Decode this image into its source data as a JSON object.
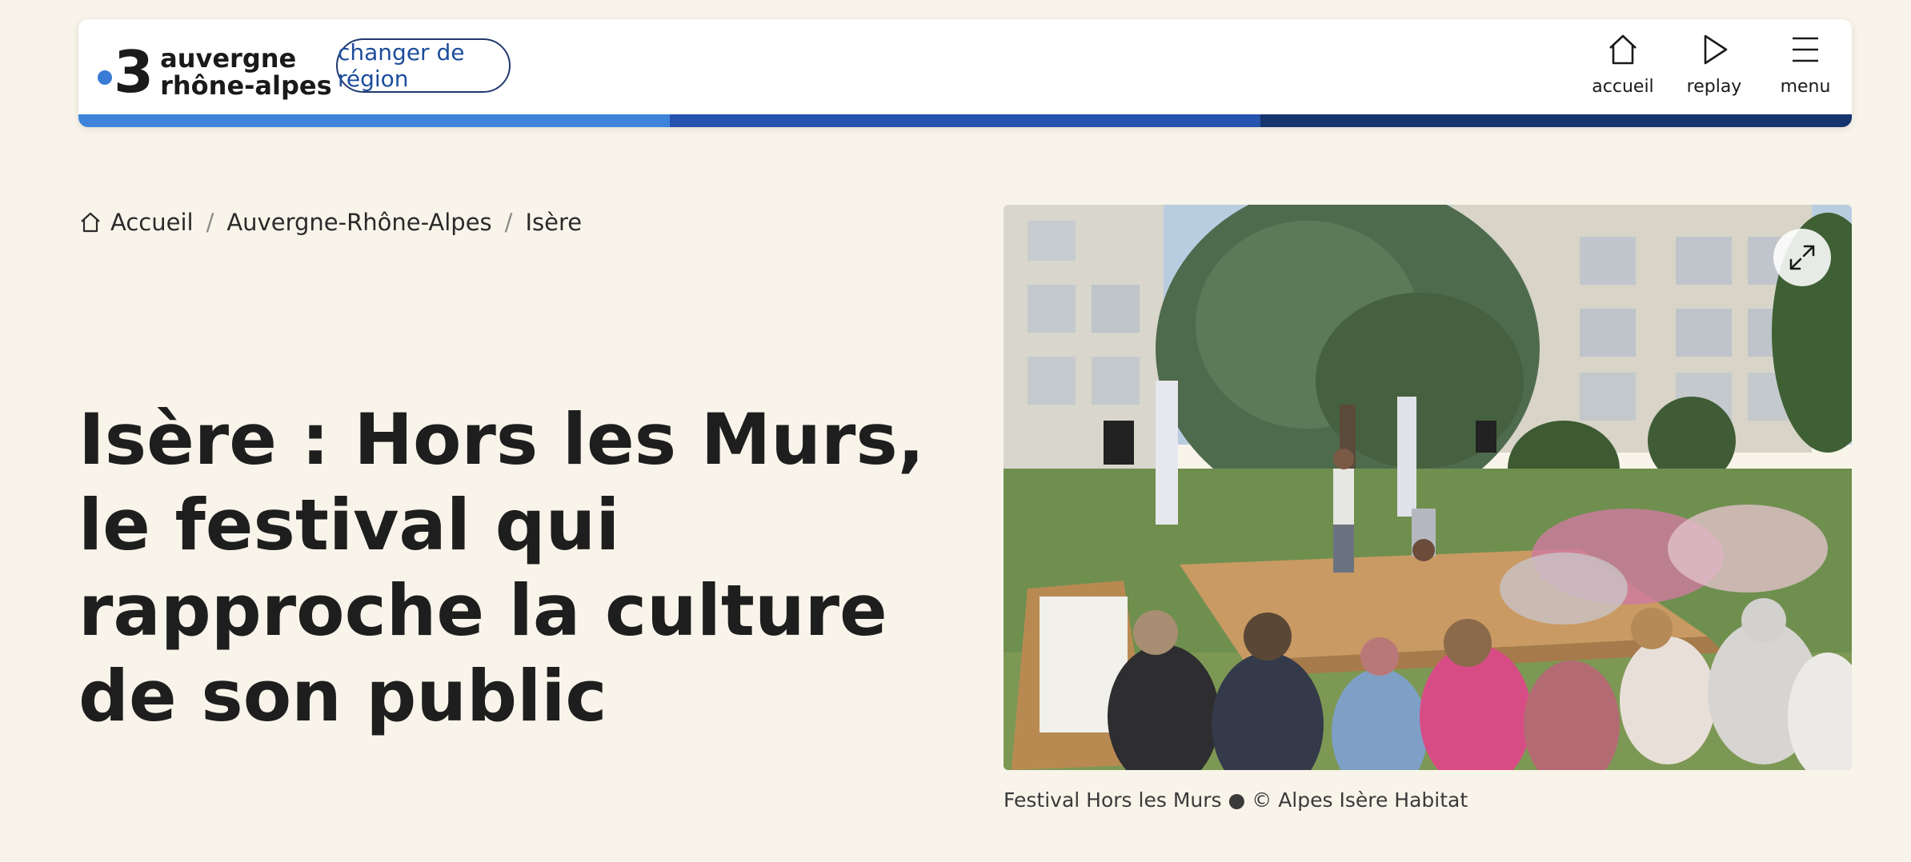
{
  "header": {
    "logo": {
      "number": "3",
      "line1": "auvergne",
      "line2": "rhône-alpes"
    },
    "change_region_label": "changer de région",
    "nav": [
      {
        "label": "accueil",
        "icon": "home-icon"
      },
      {
        "label": "replay",
        "icon": "play-icon"
      },
      {
        "label": "menu",
        "icon": "hamburger-icon"
      }
    ],
    "bar_colors": [
      "#3d84da",
      "#2553ad",
      "#16346e"
    ]
  },
  "breadcrumb": [
    {
      "label": "Accueil",
      "icon": "home-icon"
    },
    {
      "label": "Auvergne-Rhône-Alpes"
    },
    {
      "label": "Isère"
    }
  ],
  "breadcrumb_separator": "/",
  "article": {
    "title": "Isère : Hors les Murs, le festival qui rapproche la culture de son public",
    "image_caption": "Festival Hors les Murs ● © Alpes Isère Habitat",
    "expand_icon": "expand-icon"
  }
}
